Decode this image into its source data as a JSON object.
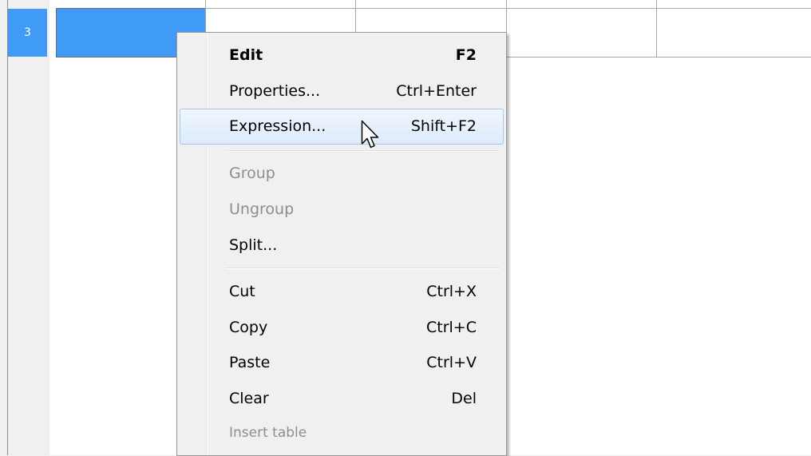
{
  "row_header": {
    "number": "3"
  },
  "context_menu": {
    "items": [
      {
        "label": "Edit",
        "shortcut": "F2",
        "bold": true,
        "enabled": true
      },
      {
        "label": "Properties...",
        "shortcut": "Ctrl+Enter",
        "enabled": true
      },
      {
        "label": "Expression...",
        "shortcut": "Shift+F2",
        "enabled": true,
        "highlighted": true
      },
      {
        "label": "Group",
        "shortcut": "",
        "enabled": false
      },
      {
        "label": "Ungroup",
        "shortcut": "",
        "enabled": false
      },
      {
        "label": "Split...",
        "shortcut": "",
        "enabled": true
      },
      {
        "label": "Cut",
        "shortcut": "Ctrl+X",
        "enabled": true
      },
      {
        "label": "Copy",
        "shortcut": "Ctrl+C",
        "enabled": true
      },
      {
        "label": "Paste",
        "shortcut": "Ctrl+V",
        "enabled": true
      },
      {
        "label": "Clear",
        "shortcut": "Del",
        "enabled": true
      },
      {
        "label": "Insert table",
        "shortcut": "",
        "enabled": false
      }
    ]
  },
  "colors": {
    "selection": "#3f9bf5",
    "menu_background": "#f0f0f0",
    "disabled_text": "#8d8d8d",
    "hover_border": "#a5c8ee"
  },
  "icons": {
    "cursor": "mouse-pointer-icon"
  }
}
